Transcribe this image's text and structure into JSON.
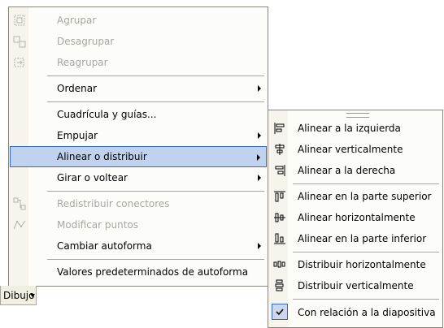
{
  "main_menu": {
    "items": [
      {
        "label": "Agrupar",
        "icon": "group-icon",
        "disabled": true
      },
      {
        "label": "Desagrupar",
        "icon": "ungroup-icon",
        "disabled": true
      },
      {
        "label": "Reagrupar",
        "icon": "regroup-icon",
        "disabled": true
      },
      {
        "label": "Ordenar",
        "submenu": true
      },
      {
        "label": "Cuadrícula y guías..."
      },
      {
        "label": "Empujar",
        "submenu": true
      },
      {
        "label": "Alinear o distribuir",
        "submenu": true,
        "highlighted": true
      },
      {
        "label": "Girar o voltear",
        "submenu": true
      },
      {
        "label": "Redistribuir conectores",
        "icon": "reroute-connectors-icon",
        "disabled": true
      },
      {
        "label": "Modificar puntos",
        "icon": "edit-points-icon",
        "disabled": true
      },
      {
        "label": "Cambiar autoforma",
        "submenu": true
      },
      {
        "label": "Valores predeterminados de autoforma"
      }
    ]
  },
  "submenu": {
    "items": [
      {
        "label": "Alinear a la izquierda",
        "icon": "align-left-icon"
      },
      {
        "label": "Alinear verticalmente",
        "icon": "align-center-icon"
      },
      {
        "label": "Alinear a la derecha",
        "icon": "align-right-icon"
      },
      {
        "label": "Alinear en la parte superior",
        "icon": "align-top-icon"
      },
      {
        "label": "Alinear horizontalmente",
        "icon": "align-middle-icon"
      },
      {
        "label": "Alinear en la parte inferior",
        "icon": "align-bottom-icon"
      },
      {
        "label": "Distribuir horizontalmente",
        "icon": "distribute-horizontal-icon"
      },
      {
        "label": "Distribuir verticalmente",
        "icon": "distribute-vertical-icon"
      },
      {
        "label": "Con relación a la diapositiva",
        "icon": "checkmark-icon",
        "checked": true
      }
    ]
  },
  "draw_toolbar": {
    "label": "Dibujo"
  },
  "colors": {
    "highlight": "#c1d2ee",
    "highlight_border": "#316ac5",
    "disabled_text": "#a8a7a1"
  }
}
